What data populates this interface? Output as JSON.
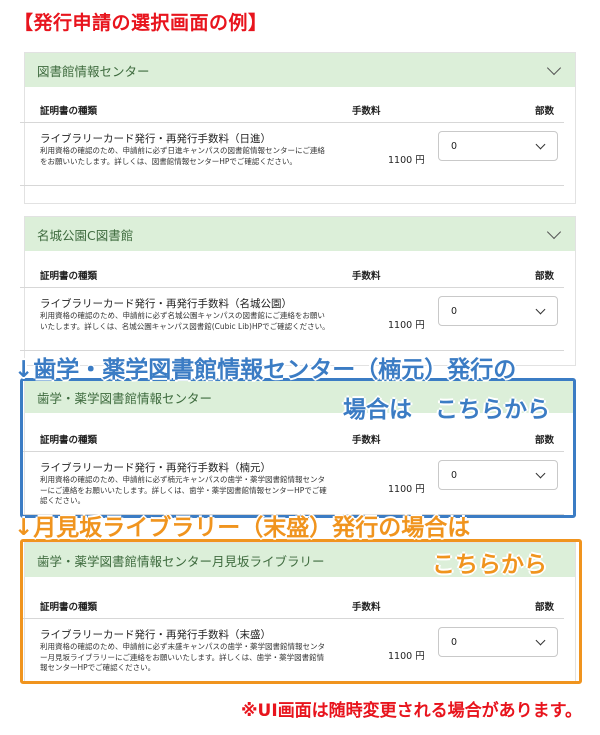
{
  "title": "【発行申請の選択画面の例】",
  "columns": {
    "type": "証明書の種類",
    "fee": "手数料",
    "qty": "部数"
  },
  "panels": [
    {
      "header": "図書館情報センター",
      "item": "ライブラリーカード発行・再発行手数料（日進）",
      "desc": "利用資格の確認のため、申請前に必ず日進キャンパスの図書館情報センターにご連絡をお願いいたします。詳しくは、図書館情報センターHPでご確認ください。",
      "price": "1100 円",
      "qty": "0"
    },
    {
      "header": "名城公園C図書館",
      "item": "ライブラリーカード発行・再発行手数料（名城公園）",
      "desc": "利用資格の確認のため、申請前に必ず名城公園キャンパスの図書館にご連絡をお願いいたします。詳しくは、名城公園キャンパス図書館(Cubic Lib)HPでご確認ください。",
      "price": "1100 円",
      "qty": "0"
    },
    {
      "header": "歯学・薬学図書館情報センター",
      "item": "ライブラリーカード発行・再発行手数料（楠元）",
      "desc": "利用資格の確認のため、申請前に必ず楠元キャンパスの歯学・薬学図書館情報センターにご連絡をお願いいたします。詳しくは、歯学・薬学図書館情報センターHPでご確認ください。",
      "price": "1100 円",
      "qty": "0"
    },
    {
      "header": "歯学・薬学図書館情報センター月見坂ライブラリー",
      "item": "ライブラリーカード発行・再発行手数料（末盛）",
      "desc": "利用資格の確認のため、申請前に必ず末盛キャンパスの歯学・薬学図書館情報センター月見坂ライブラリーにご連絡をお願いいたします。詳しくは、歯学・薬学図書館情報センターHPでご確認ください。",
      "price": "1100 円",
      "qty": "0"
    }
  ],
  "callout_blue_line1": "↓歯学・薬学図書館情報センター（楠元）発行の",
  "callout_blue_line2": "場合は　こちらから",
  "callout_orange_line1": "↓月見坂ライブラリー（末盛）発行の場合は",
  "callout_orange_line2": "こちらから",
  "note": "※UI画面は随時変更される場合があります。",
  "colors": {
    "red": "#e8141d",
    "blue": "#3b7cc4",
    "orange": "#f0941e",
    "header_green": "#dcefd9"
  }
}
